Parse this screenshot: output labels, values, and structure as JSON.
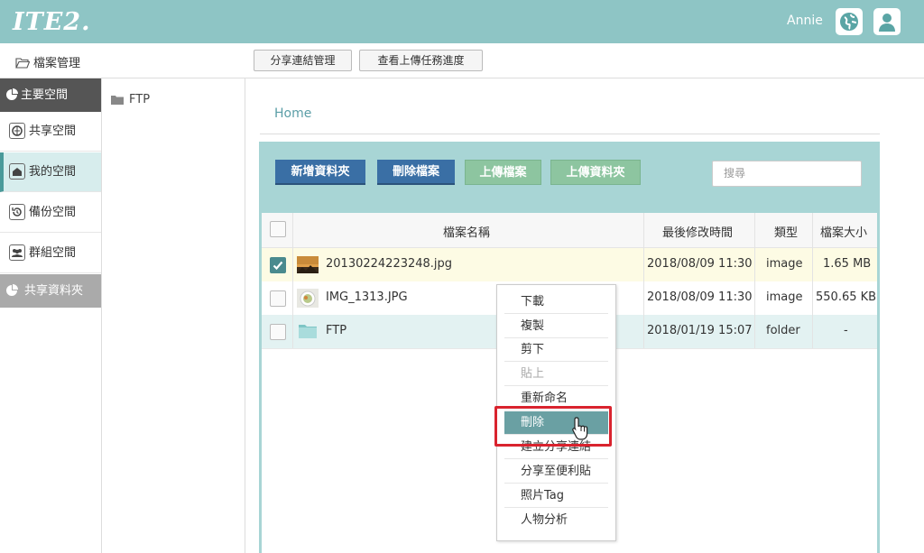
{
  "header": {
    "logo": "ITE2.",
    "username": "Annie",
    "icons": [
      "globe-icon",
      "user-icon"
    ]
  },
  "toolbar": {
    "file_manager": "檔案管理",
    "share_link_mgmt": "分享連結管理",
    "upload_progress": "查看上傳任務進度"
  },
  "sidebar": {
    "main_space": "主要空間",
    "items": [
      {
        "label": "共享空間",
        "icon": "globe-icon"
      },
      {
        "label": "我的空間",
        "icon": "home-icon"
      },
      {
        "label": "備份空間",
        "icon": "backup-icon"
      },
      {
        "label": "群組空間",
        "icon": "group-icon"
      }
    ],
    "shared_folder": "共享資料夾"
  },
  "tree": {
    "root": "FTP"
  },
  "breadcrumb": "Home",
  "actions": {
    "new_folder": "新增資料夾",
    "delete_files": "刪除檔案",
    "upload_file": "上傳檔案",
    "upload_folder": "上傳資料夾",
    "search_placeholder": "搜尋"
  },
  "table": {
    "headers": {
      "name": "檔案名稱",
      "modified": "最後修改時間",
      "type": "類型",
      "size": "檔案大小"
    },
    "rows": [
      {
        "name": "20130224223248.jpg",
        "modified": "2018/08/09 11:30",
        "type": "image",
        "size": "1.65 MB",
        "checked": true
      },
      {
        "name": "IMG_1313.JPG",
        "modified": "2018/08/09 11:30",
        "type": "image",
        "size": "550.65 KB",
        "checked": false
      },
      {
        "name": "FTP",
        "modified": "2018/01/19 15:07",
        "type": "folder",
        "size": "-",
        "checked": false
      }
    ]
  },
  "context_menu": {
    "items": [
      "下載",
      "複製",
      "剪下",
      "貼上",
      "重新命名",
      "刪除",
      "建立分享連結",
      "分享至便利貼",
      "照片Tag",
      "人物分析"
    ],
    "disabled": "貼上",
    "highlighted": "刪除"
  },
  "colors": {
    "header": "#8ec5c5",
    "panel": "#a8d5d5",
    "blue_button": "#3a6fa5",
    "green_button": "#8dc5a0",
    "highlight_box": "#d9232e"
  }
}
